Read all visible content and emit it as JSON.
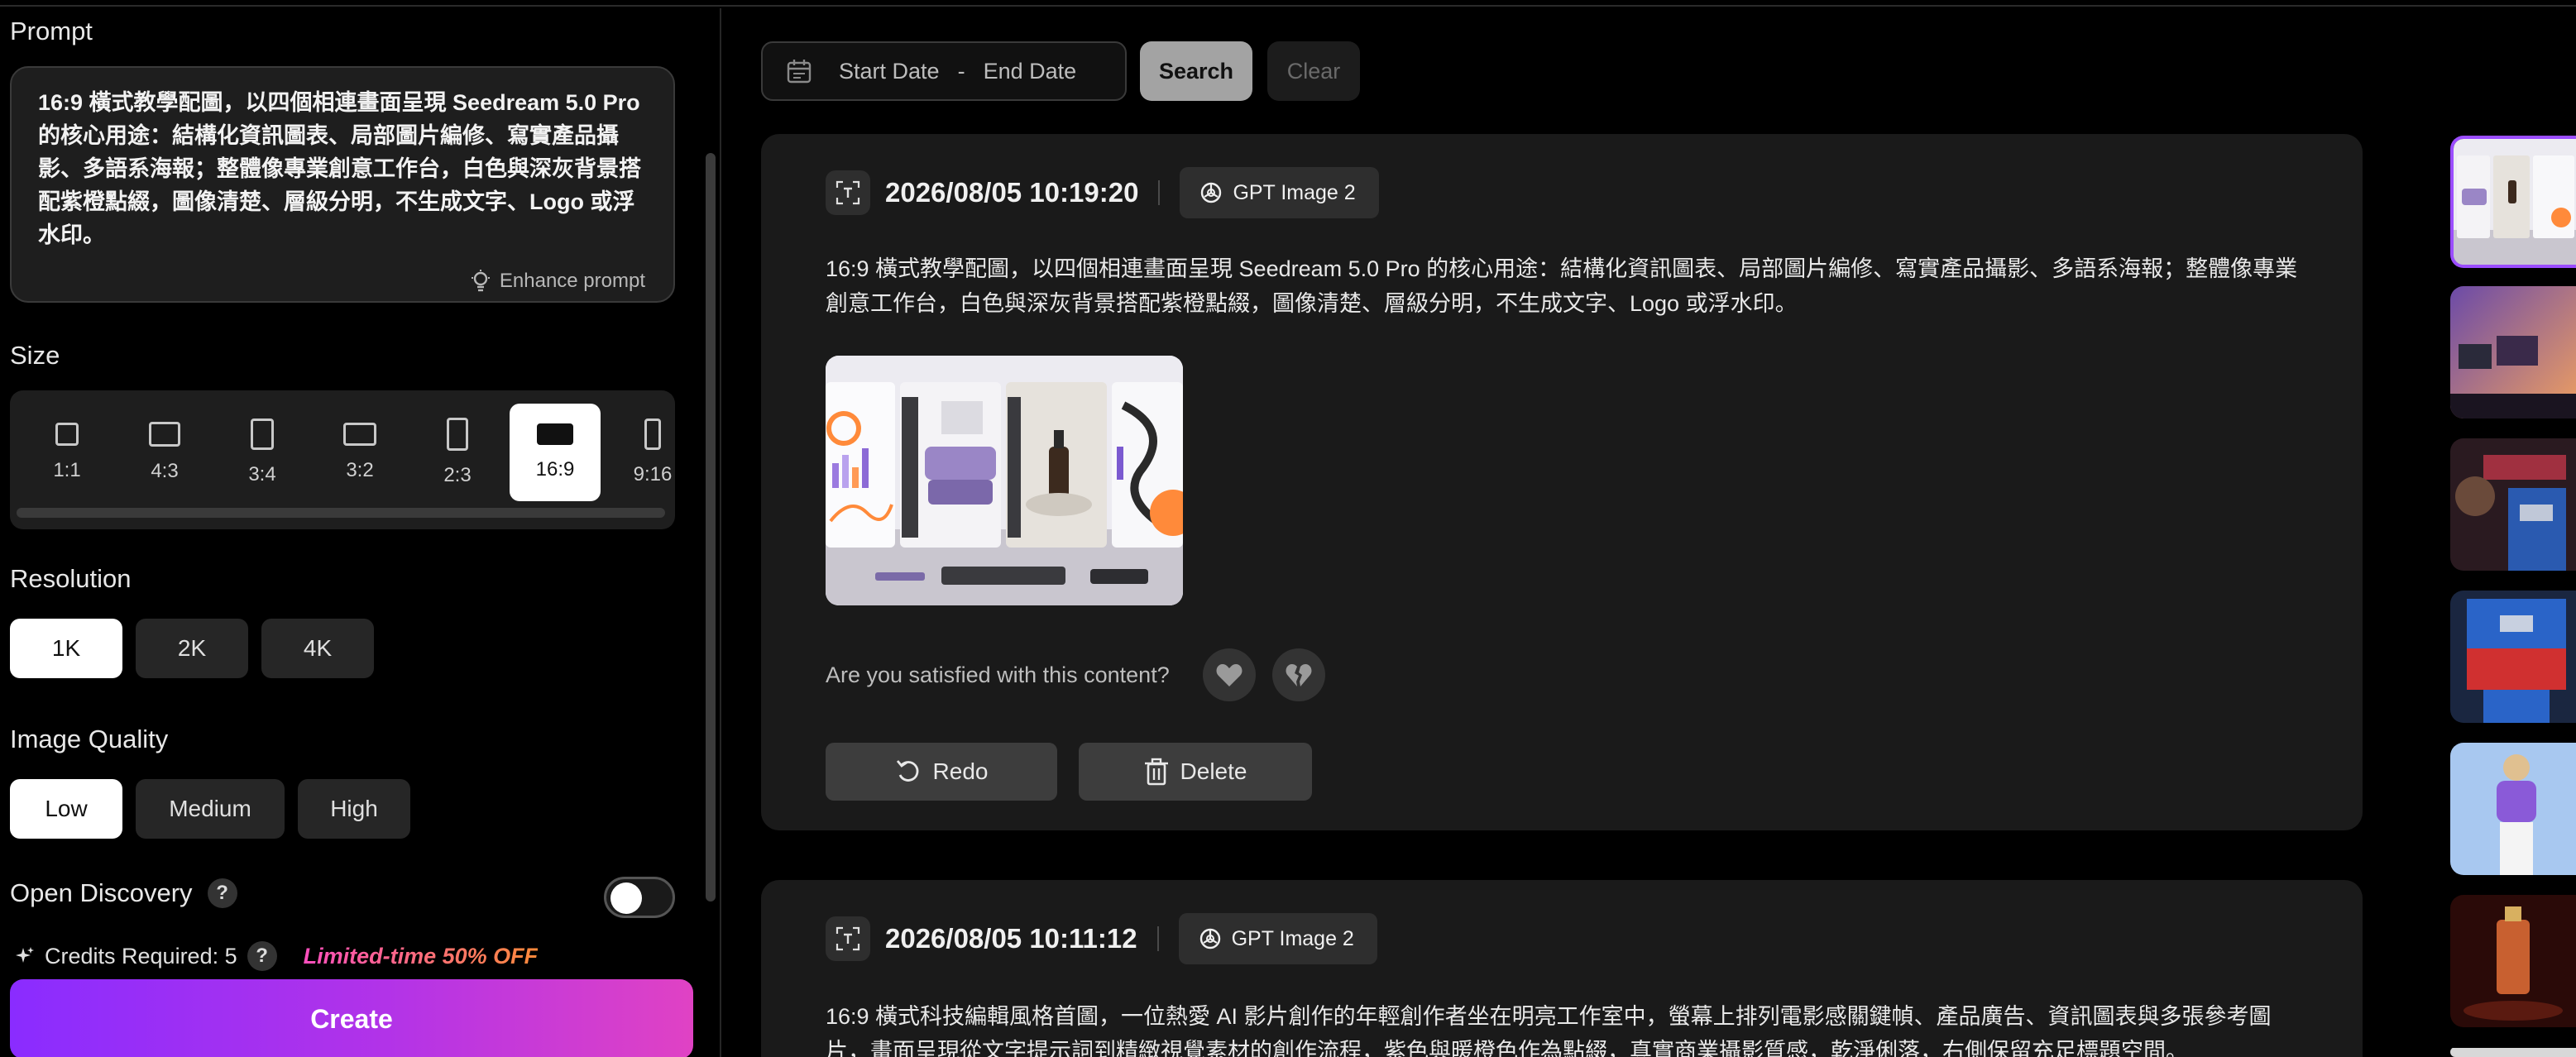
{
  "left": {
    "prompt": {
      "title": "Prompt",
      "value": "16:9 橫式教學配圖，以四個相連畫面呈現 Seedream 5.0 Pro 的核心用途：結構化資訊圖表、局部圖片編修、寫實產品攝影、多語系海報；整體像專業創意工作台，白色與深灰背景搭配紫橙點綴，圖像清楚、層級分明，不生成文字、Logo 或浮水印。",
      "enhance_label": "Enhance prompt"
    },
    "size": {
      "title": "Size",
      "options": [
        "1:1",
        "4:3",
        "3:4",
        "3:2",
        "2:3",
        "16:9",
        "9:16"
      ],
      "selected": "16:9"
    },
    "resolution": {
      "title": "Resolution",
      "options": [
        "1K",
        "2K",
        "4K"
      ],
      "selected": "1K"
    },
    "quality": {
      "title": "Image Quality",
      "options": [
        "Low",
        "Medium",
        "High"
      ],
      "selected": "Low"
    },
    "discovery": {
      "label": "Open Discovery",
      "help": "?",
      "enabled": false
    },
    "credits": {
      "label": "Credits Required: 5",
      "help": "?",
      "promo": "Limited-time 50% OFF"
    },
    "create_label": "Create"
  },
  "filters": {
    "start_placeholder": "Start Date",
    "separator": "-",
    "end_placeholder": "End Date",
    "search_label": "Search",
    "clear_label": "Clear"
  },
  "cards": [
    {
      "time": "2026/08/05 10:19:20",
      "model": "GPT Image 2",
      "prompt": "16:9 橫式教學配圖，以四個相連畫面呈現 Seedream 5.0 Pro 的核心用途：結構化資訊圖表、局部圖片編修、寫實產品攝影、多語系海報；整體像專業創意工作台，白色與深灰背景搭配紫橙點綴，圖像清楚、層級分明，不生成文字、Logo 或浮水印。",
      "satisfaction_question": "Are you satisfied with this content?",
      "redo_label": "Redo",
      "delete_label": "Delete"
    },
    {
      "time": "2026/08/05 10:11:12",
      "model": "GPT Image 2",
      "prompt": "16:9 橫式科技編輯風格首圖，一位熱愛 AI 影片創作的年輕創作者坐在明亮工作室中，螢幕上排列電影感關鍵幀、產品廣告、資訊圖表與多張參考圖片，畫面呈現從文字提示詞到精緻視覺素材的創作流程，紫色與暖橙色作為點綴，真實商業攝影質感，乾淨俐落，右側保留充足標題空間。"
    }
  ],
  "colors": {
    "accent_purple": "#8a2cff",
    "accent_pink": "#e042c4",
    "promo_pink": "#ff4fbf",
    "promo_orange": "#ff8a3a",
    "selected_border": "#9b4dff"
  }
}
